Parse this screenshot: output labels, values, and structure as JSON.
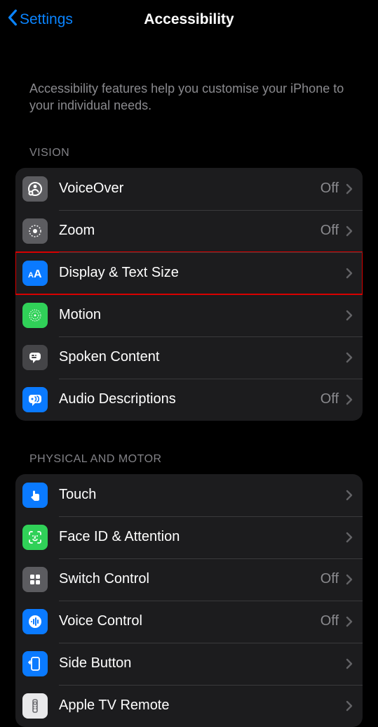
{
  "nav": {
    "back_label": "Settings",
    "title": "Accessibility"
  },
  "intro": "Accessibility features help you customise your iPhone to your individual needs.",
  "sections": {
    "vision": {
      "header": "VISION",
      "items": {
        "voiceover": {
          "label": "VoiceOver",
          "value": "Off"
        },
        "zoom": {
          "label": "Zoom",
          "value": "Off"
        },
        "display": {
          "label": "Display & Text Size",
          "value": ""
        },
        "motion": {
          "label": "Motion",
          "value": ""
        },
        "spoken": {
          "label": "Spoken Content",
          "value": ""
        },
        "audio_desc": {
          "label": "Audio Descriptions",
          "value": "Off"
        }
      }
    },
    "physical": {
      "header": "PHYSICAL AND MOTOR",
      "items": {
        "touch": {
          "label": "Touch",
          "value": ""
        },
        "faceid": {
          "label": "Face ID & Attention",
          "value": ""
        },
        "switch": {
          "label": "Switch Control",
          "value": "Off"
        },
        "voice": {
          "label": "Voice Control",
          "value": "Off"
        },
        "side": {
          "label": "Side Button",
          "value": ""
        },
        "appletv": {
          "label": "Apple TV Remote",
          "value": ""
        }
      }
    }
  }
}
